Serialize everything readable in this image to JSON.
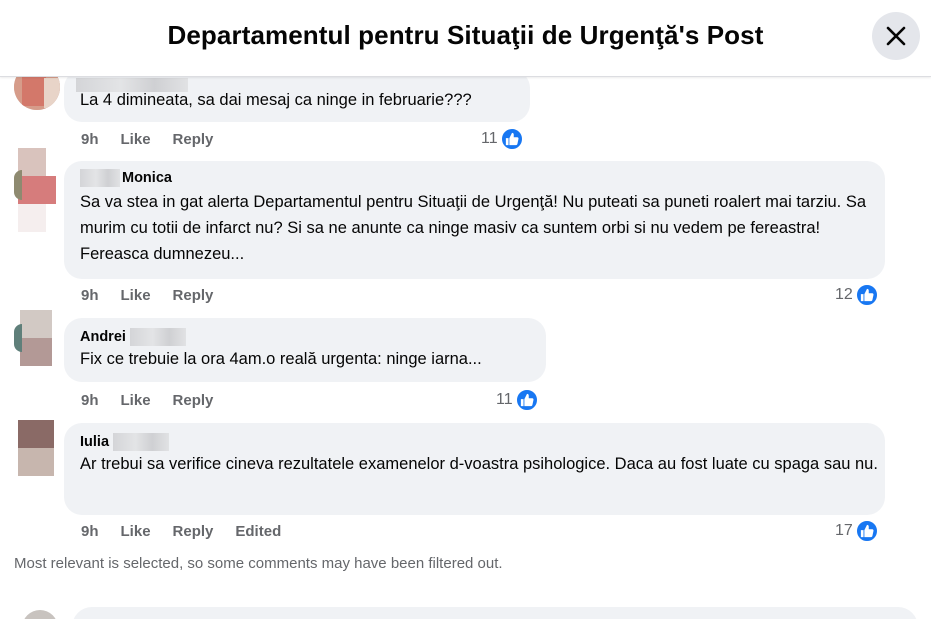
{
  "header": {
    "title": "Departamentul pentru Situaţii de Urgenţă's Post"
  },
  "comments": [
    {
      "author": "",
      "text": "La 4 dimineata, sa dai mesaj ca ninge in februarie???",
      "time": "9h",
      "like": "Like",
      "reply": "Reply",
      "reactions": "11"
    },
    {
      "author": "Monica",
      "text": "Sa va stea in gat alerta Departamentul pentru Situaţii de Urgenţă! Nu puteati sa puneti roalert mai tarziu. Sa murim cu totii de infarct nu? Si sa ne anunte ca ninge masiv ca suntem orbi si nu vedem pe fereastra! Fereasca dumnezeu...",
      "time": "9h",
      "like": "Like",
      "reply": "Reply",
      "reactions": "12"
    },
    {
      "author": "Andrei",
      "text": "Fix ce trebuie la ora 4am.o reală urgenta: ninge iarna...",
      "time": "9h",
      "like": "Like",
      "reply": "Reply",
      "reactions": "11"
    },
    {
      "author": "Iulia",
      "text": "Ar trebui sa verifice cineva rezultatele examenelor d-voastra psihologice. Daca au fost luate cu spaga sau nu.",
      "time": "9h",
      "like": "Like",
      "reply": "Reply",
      "edited": "Edited",
      "reactions": "17"
    }
  ],
  "footer": {
    "filter_note": "Most relevant is selected, so some comments may have been filtered out."
  },
  "icons": {
    "close": "close-icon",
    "like": "like-thumb-icon"
  },
  "colors": {
    "accent": "#1877f2",
    "bubble": "#f0f2f5",
    "muted": "#65676b"
  }
}
